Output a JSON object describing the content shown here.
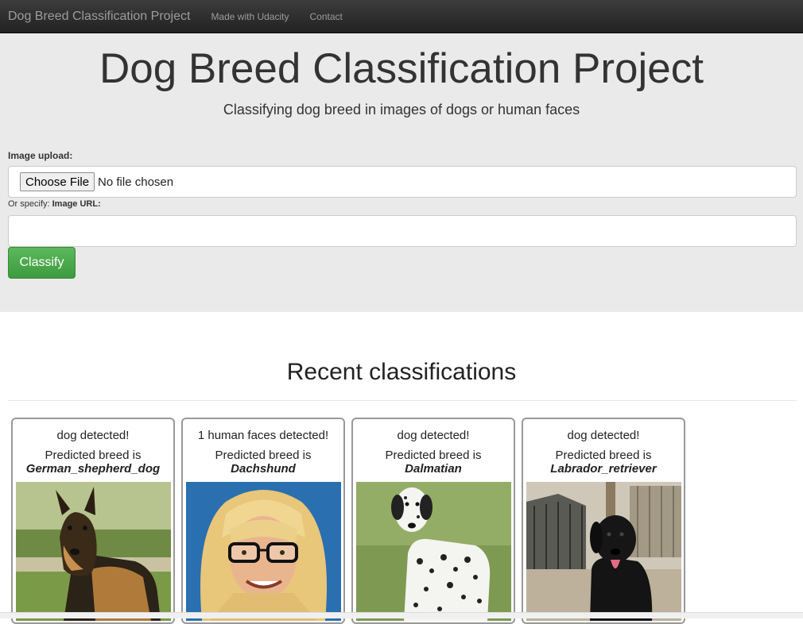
{
  "navbar": {
    "brand": "Dog Breed Classification Project",
    "links": [
      "Made with Udacity",
      "Contact"
    ]
  },
  "header": {
    "title": "Dog Breed Classification Project",
    "subtitle": "Classifying dog breed in images of dogs or human faces"
  },
  "form": {
    "upload_label": "Image upload:",
    "choose_button": "Choose File",
    "no_file_text": "No file chosen",
    "specify_prefix": "Or specify: ",
    "url_label": "Image URL:",
    "url_value": "",
    "classify_button": "Classify"
  },
  "recent": {
    "title": "Recent classifications",
    "cards": [
      {
        "status": "dog detected!",
        "predicted_label": "Predicted breed is",
        "breed": "German_shepherd_dog",
        "image_icon": "german-shepherd-photo"
      },
      {
        "status": "1 human faces detected!",
        "predicted_label": "Predicted breed is",
        "breed": "Dachshund",
        "image_icon": "human-face-photo"
      },
      {
        "status": "dog detected!",
        "predicted_label": "Predicted breed is",
        "breed": "Dalmatian",
        "image_icon": "dalmatian-photo"
      },
      {
        "status": "dog detected!",
        "predicted_label": "Predicted breed is",
        "breed": "Labrador_retriever",
        "image_icon": "labrador-photo"
      }
    ]
  },
  "colors": {
    "navbar": "#222222",
    "jumbotron": "#eaeaeb",
    "classify_button": "#4cae4c"
  }
}
